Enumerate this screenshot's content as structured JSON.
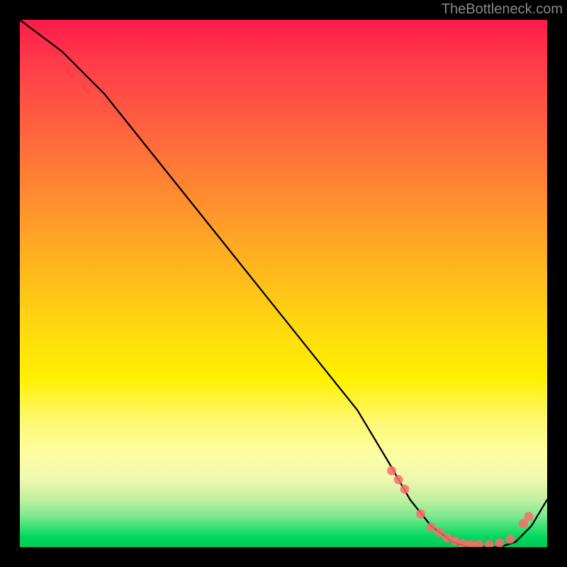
{
  "watermark": "TheBottleneck.com",
  "chart_data": {
    "type": "line",
    "title": "",
    "xlabel": "",
    "ylabel": "",
    "xlim": [
      0,
      100
    ],
    "ylim": [
      0,
      100
    ],
    "grid": false,
    "annotations": [],
    "series": [
      {
        "name": "bottleneck-curve",
        "color": "#000000",
        "x": [
          0,
          8,
          16,
          24,
          32,
          40,
          48,
          56,
          64,
          70,
          74,
          78,
          82,
          85,
          88,
          91,
          94,
          97,
          100
        ],
        "values": [
          100,
          94,
          86,
          76,
          66,
          56,
          46,
          36,
          26,
          16,
          9,
          4,
          1,
          0,
          0,
          0,
          1,
          4,
          9
        ]
      }
    ],
    "markers": [
      {
        "name": "highlight-points",
        "color": "#ff6b6b",
        "x": [
          70.5,
          71.8,
          73,
          76,
          78,
          79.5,
          81,
          82.5,
          84,
          85.5,
          87,
          89,
          91,
          93,
          95.5,
          96.5
        ],
        "values": [
          14.5,
          12.8,
          11,
          6.3,
          3.8,
          2.8,
          1.8,
          1.2,
          0.7,
          0.5,
          0.5,
          0.5,
          0.8,
          1.5,
          4.5,
          5.8
        ]
      }
    ],
    "background_gradient": {
      "orientation": "vertical",
      "stops": [
        {
          "pos": 0,
          "color": "#ff1a4a"
        },
        {
          "pos": 50,
          "color": "#ffc010"
        },
        {
          "pos": 80,
          "color": "#fff870"
        },
        {
          "pos": 100,
          "color": "#00d060"
        }
      ]
    }
  }
}
